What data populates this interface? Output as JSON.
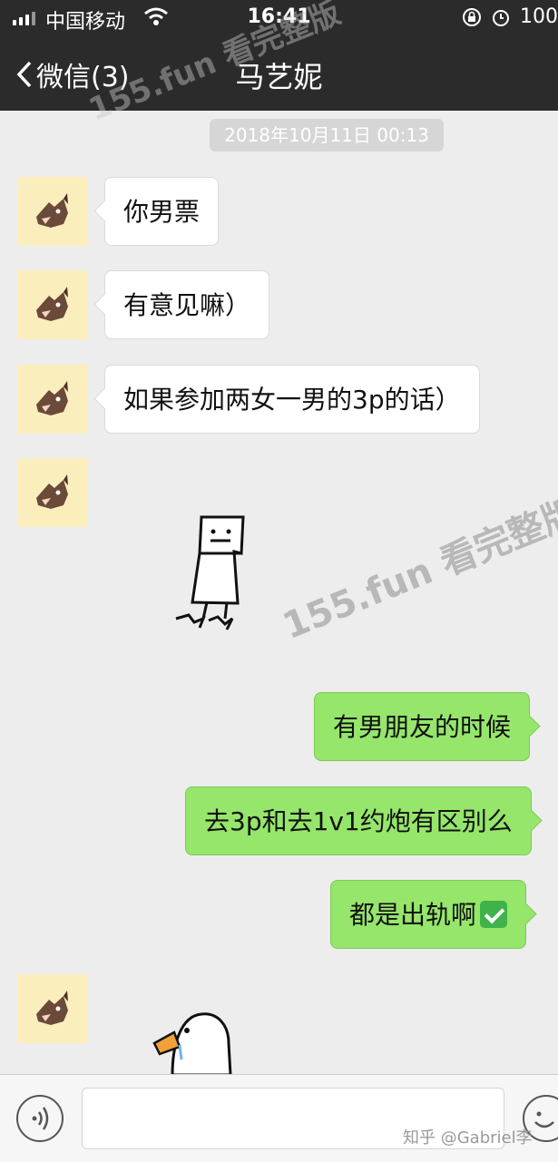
{
  "status_bar": {
    "carrier": "中国移动",
    "time": "16:41",
    "battery": "100"
  },
  "nav": {
    "back_label": "微信(3)",
    "title": "马艺妮"
  },
  "watermark": "155.fun 看完整版",
  "chat": {
    "timestamp": "2018年10月11日 00:13",
    "messages": [
      {
        "side": "in",
        "text": "你男票"
      },
      {
        "side": "in",
        "text": "有意见嘛）"
      },
      {
        "side": "in",
        "text": "如果参加两女一男的3p的话）"
      },
      {
        "side": "in",
        "type": "sticker",
        "sticker": "rectangle-man-sticker"
      },
      {
        "side": "out",
        "text": "有男朋友的时候"
      },
      {
        "side": "out",
        "text": "去3p和去1v1约炮有区别么"
      },
      {
        "side": "out",
        "text": "都是出轨啊",
        "emoji": "check-mark-icon"
      },
      {
        "side": "in",
        "type": "sticker",
        "sticker": "goose-sticker"
      }
    ]
  },
  "input_bar": {
    "placeholder": ""
  },
  "source_tag": "知乎 @Gabriel李",
  "colors": {
    "nav_bg": "#2b2b2b",
    "chat_bg": "#ededed",
    "outgoing_bubble": "#95e66b",
    "incoming_bubble": "#ffffff",
    "avatar_bg": "#fbeebd"
  }
}
